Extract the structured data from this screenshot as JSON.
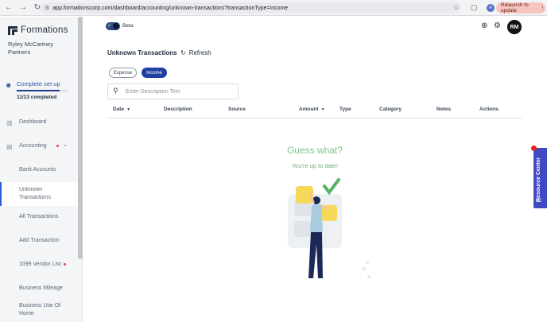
{
  "browser": {
    "url": "app.formationscorp.com/dashboard/accounting/unknown-transactions?transactionType=income",
    "profile_initial": "A",
    "relaunch_label": "Relaunch to update"
  },
  "sidebar": {
    "brand": "Formations",
    "client_name": "Ryley McCartney Partners",
    "setup": {
      "label": "Complete set up",
      "progress": "11/13 completed",
      "fraction": 0.8462
    },
    "items": [
      {
        "label": "Dashboard",
        "icon": "bar-chart-icon"
      },
      {
        "label": "Accounting",
        "icon": "ledger-icon",
        "badge": true,
        "expanded": true
      },
      {
        "label": "Bank Accounts"
      },
      {
        "label": "Unknown Transactions",
        "active": true
      },
      {
        "label": "All Transactions"
      },
      {
        "label": "Add Transaction"
      },
      {
        "label": "1099 Vendor List",
        "badge": true
      },
      {
        "label": "Business Mileage"
      },
      {
        "label": "Business Use Of Home"
      }
    ]
  },
  "topbar": {
    "beta_label": "Beta",
    "beta_enabled": true,
    "avatar_initials": "RM"
  },
  "main": {
    "title": "Unknown Transactions",
    "refresh_label": "Refresh",
    "filters": [
      {
        "label": "Expense",
        "selected": false
      },
      {
        "label": "Income",
        "selected": true
      }
    ],
    "search": {
      "placeholder": "Enter Description Text",
      "value": ""
    },
    "columns": [
      {
        "label": "Date",
        "sortable": true
      },
      {
        "label": "Description",
        "sortable": false
      },
      {
        "label": "Source",
        "sortable": false
      },
      {
        "label": "Amount",
        "sortable": true
      },
      {
        "label": "Type",
        "sortable": false
      },
      {
        "label": "Category",
        "sortable": false
      },
      {
        "label": "Notes",
        "sortable": false
      },
      {
        "label": "Actions",
        "sortable": false
      }
    ],
    "empty_state": {
      "title": "Guess what?",
      "subtitle": "You're up to date!"
    }
  },
  "resource_center": {
    "label": "Resource Center"
  },
  "colors": {
    "brand_blue": "#1f3fa3",
    "success_green": "#7ec58a",
    "alert_red": "#e0463a",
    "resource_purple": "#3f49c4"
  }
}
